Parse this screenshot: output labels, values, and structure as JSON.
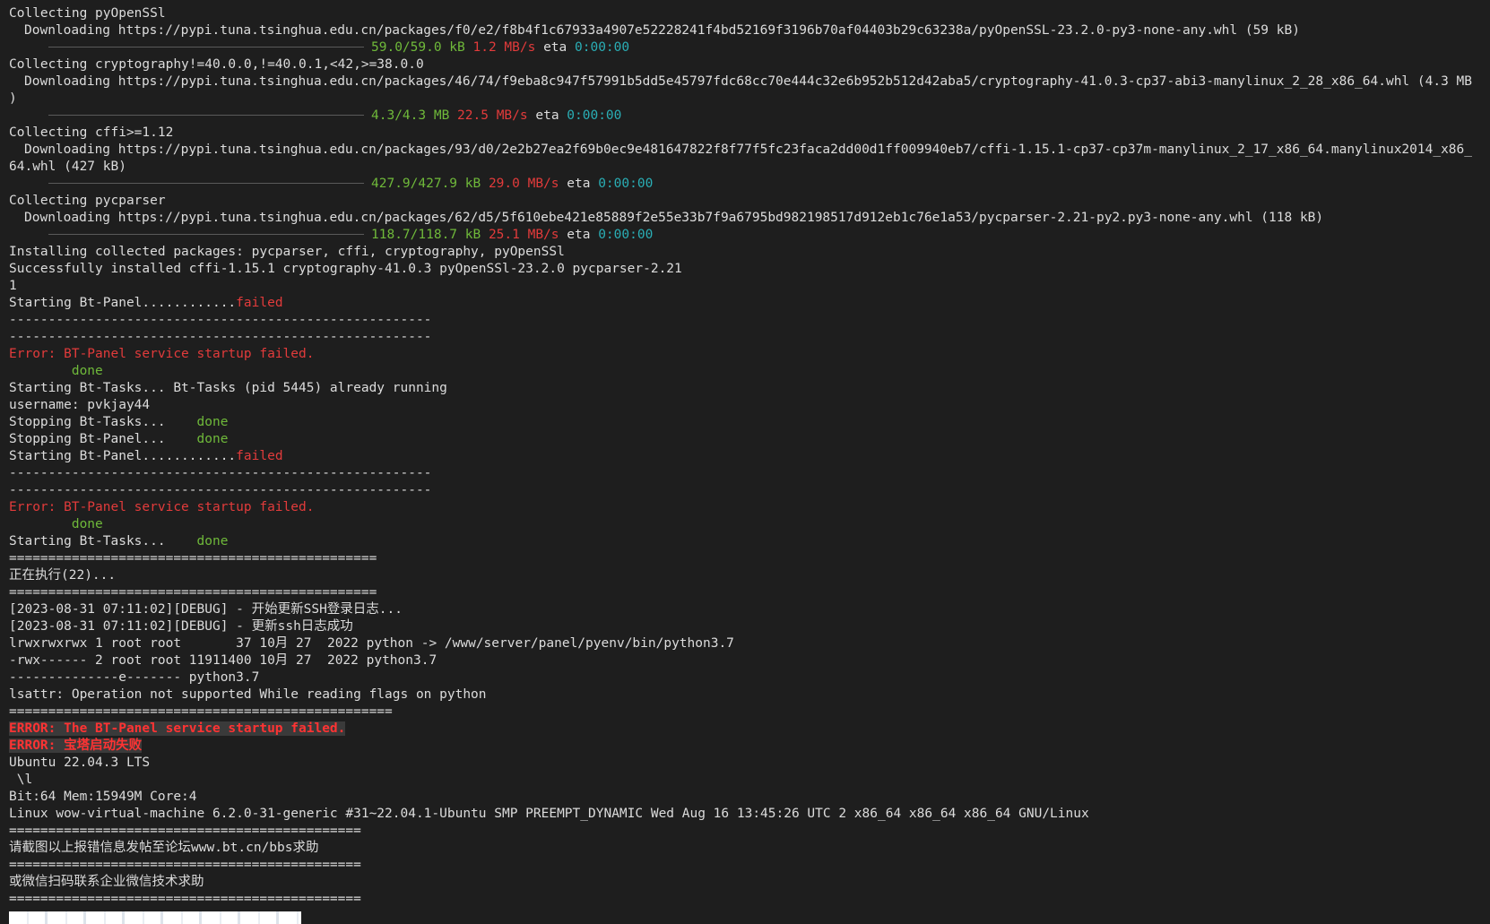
{
  "terminal": {
    "lines": [
      {
        "segments": [
          {
            "text": "Collecting pyOpenSSl",
            "color": "white"
          }
        ]
      },
      {
        "indent": true,
        "segments": [
          {
            "text": "Downloading https://pypi.tuna.tsinghua.edu.cn/packages/f0/e2/f8b4f1c67933a4907e52228241f4bd52169f3196b70af04403b29c63238a/pyOpenSSL-23.2.0-py3-none-any.whl (59 kB)",
            "color": "white"
          }
        ]
      },
      {
        "bar": true,
        "segments": [
          {
            "text": "59.0/59.0 kB",
            "color": "green"
          },
          {
            "text": " ",
            "color": "white"
          },
          {
            "text": "1.2 MB/s",
            "color": "red"
          },
          {
            "text": " eta ",
            "color": "white"
          },
          {
            "text": "0:00:00",
            "color": "cyan"
          }
        ]
      },
      {
        "segments": [
          {
            "text": "Collecting cryptography!=40.0.0,!=40.0.1,<42,>=38.0.0",
            "color": "white"
          }
        ]
      },
      {
        "indent": true,
        "segments": [
          {
            "text": "Downloading https://pypi.tuna.tsinghua.edu.cn/packages/46/74/f9eba8c947f57991b5dd5e45797fdc68cc70e444c32e6b952b512d42aba5/cryptography-41.0.3-cp37-abi3-manylinux_2_28_x86_64.whl (4.3 MB",
            "color": "white"
          }
        ]
      },
      {
        "segments": [
          {
            "text": ")",
            "color": "white"
          }
        ]
      },
      {
        "bar": true,
        "segments": [
          {
            "text": "4.3/4.3 MB",
            "color": "green"
          },
          {
            "text": " ",
            "color": "white"
          },
          {
            "text": "22.5 MB/s",
            "color": "red"
          },
          {
            "text": " eta ",
            "color": "white"
          },
          {
            "text": "0:00:00",
            "color": "cyan"
          }
        ]
      },
      {
        "segments": [
          {
            "text": "Collecting cffi>=1.12",
            "color": "white"
          }
        ]
      },
      {
        "indent": true,
        "segments": [
          {
            "text": "Downloading https://pypi.tuna.tsinghua.edu.cn/packages/93/d0/2e2b27ea2f69b0ec9e481647822f8f77f5fc23faca2dd00d1ff009940eb7/cffi-1.15.1-cp37-cp37m-manylinux_2_17_x86_64.manylinux2014_x86_",
            "color": "white"
          }
        ]
      },
      {
        "segments": [
          {
            "text": "64.whl (427 kB)",
            "color": "white"
          }
        ]
      },
      {
        "bar": true,
        "segments": [
          {
            "text": "427.9/427.9 kB",
            "color": "green"
          },
          {
            "text": " ",
            "color": "white"
          },
          {
            "text": "29.0 MB/s",
            "color": "red"
          },
          {
            "text": " eta ",
            "color": "white"
          },
          {
            "text": "0:00:00",
            "color": "cyan"
          }
        ]
      },
      {
        "segments": [
          {
            "text": "Collecting pycparser",
            "color": "white"
          }
        ]
      },
      {
        "indent": true,
        "segments": [
          {
            "text": "Downloading https://pypi.tuna.tsinghua.edu.cn/packages/62/d5/5f610ebe421e85889f2e55e33b7f9a6795bd982198517d912eb1c76e1a53/pycparser-2.21-py2.py3-none-any.whl (118 kB)",
            "color": "white"
          }
        ]
      },
      {
        "bar": true,
        "segments": [
          {
            "text": "118.7/118.7 kB",
            "color": "green"
          },
          {
            "text": " ",
            "color": "white"
          },
          {
            "text": "25.1 MB/s",
            "color": "red"
          },
          {
            "text": " eta ",
            "color": "white"
          },
          {
            "text": "0:00:00",
            "color": "cyan"
          }
        ]
      },
      {
        "segments": [
          {
            "text": "Installing collected packages: pycparser, cffi, cryptography, pyOpenSSl",
            "color": "white"
          }
        ]
      },
      {
        "segments": [
          {
            "text": "Successfully installed cffi-1.15.1 cryptography-41.0.3 pyOpenSSl-23.2.0 pycparser-2.21",
            "color": "white"
          }
        ]
      },
      {
        "segments": [
          {
            "text": "1",
            "color": "white"
          }
        ]
      },
      {
        "segments": [
          {
            "text": "Starting Bt-Panel............",
            "color": "white"
          },
          {
            "text": "failed",
            "color": "red"
          }
        ]
      },
      {
        "segments": [
          {
            "text": "------------------------------------------------------",
            "color": "white"
          }
        ]
      },
      {
        "segments": [
          {
            "text": "------------------------------------------------------",
            "color": "white"
          }
        ]
      },
      {
        "segments": [
          {
            "text": "Error: BT-Panel service startup failed.",
            "color": "err"
          }
        ]
      },
      {
        "segments": [
          {
            "text": "        done",
            "color": "green"
          }
        ]
      },
      {
        "segments": [
          {
            "text": "Starting Bt-Tasks... Bt-Tasks (pid 5445) already running",
            "color": "white"
          }
        ]
      },
      {
        "segments": [
          {
            "text": "username: pvkjay44",
            "color": "white"
          }
        ]
      },
      {
        "segments": [
          {
            "text": "Stopping Bt-Tasks...    ",
            "color": "white"
          },
          {
            "text": "done",
            "color": "green"
          }
        ]
      },
      {
        "segments": [
          {
            "text": "Stopping Bt-Panel...    ",
            "color": "white"
          },
          {
            "text": "done",
            "color": "green"
          }
        ]
      },
      {
        "segments": [
          {
            "text": "Starting Bt-Panel............",
            "color": "white"
          },
          {
            "text": "failed",
            "color": "red"
          }
        ]
      },
      {
        "segments": [
          {
            "text": "------------------------------------------------------",
            "color": "white"
          }
        ]
      },
      {
        "segments": [
          {
            "text": "------------------------------------------------------",
            "color": "white"
          }
        ]
      },
      {
        "segments": [
          {
            "text": "Error: BT-Panel service startup failed.",
            "color": "err"
          }
        ]
      },
      {
        "segments": [
          {
            "text": "        done",
            "color": "green"
          }
        ]
      },
      {
        "segments": [
          {
            "text": "Starting Bt-Tasks...    ",
            "color": "white"
          },
          {
            "text": "done",
            "color": "green"
          }
        ]
      },
      {
        "segments": [
          {
            "text": "===============================================",
            "color": "white"
          }
        ]
      },
      {
        "segments": [
          {
            "text": "正在执行(22)...",
            "color": "white"
          }
        ]
      },
      {
        "segments": [
          {
            "text": "===============================================",
            "color": "white"
          }
        ]
      },
      {
        "segments": [
          {
            "text": "[2023-08-31 07:11:02][DEBUG] - 开始更新SSH登录日志...",
            "color": "white"
          }
        ]
      },
      {
        "segments": [
          {
            "text": "[2023-08-31 07:11:02][DEBUG] - 更新ssh日志成功",
            "color": "white"
          }
        ]
      },
      {
        "segments": [
          {
            "text": "lrwxrwxrwx 1 root root       37 10月 27  2022 python -> /www/server/panel/pyenv/bin/python3.7",
            "color": "white"
          }
        ]
      },
      {
        "segments": [
          {
            "text": "-rwx------ 2 root root 11911400 10月 27  2022 python3.7",
            "color": "white"
          }
        ]
      },
      {
        "segments": [
          {
            "text": "--------------e------- python3.7",
            "color": "white"
          }
        ]
      },
      {
        "segments": [
          {
            "text": "lsattr: Operation not supported While reading flags on python",
            "color": "white"
          }
        ]
      },
      {
        "segments": [
          {
            "text": "=================================================",
            "color": "white"
          }
        ]
      },
      {
        "segments": [
          {
            "text": "ERROR: The BT-Panel service startup failed.",
            "color": "hl"
          }
        ]
      },
      {
        "segments": [
          {
            "text": "ERROR: 宝塔启动失败",
            "color": "hl"
          }
        ]
      },
      {
        "segments": [
          {
            "text": "Ubuntu 22.04.3 LTS",
            "color": "white"
          }
        ]
      },
      {
        "segments": [
          {
            "text": " \\l",
            "color": "white"
          }
        ]
      },
      {
        "segments": [
          {
            "text": "Bit:64 Mem:15949M Core:4",
            "color": "white"
          }
        ]
      },
      {
        "segments": [
          {
            "text": "Linux wow-virtual-machine 6.2.0-31-generic #31~22.04.1-Ubuntu SMP PREEMPT_DYNAMIC Wed Aug 16 13:45:26 UTC 2 x86_64 x86_64 x86_64 GNU/Linux",
            "color": "white"
          }
        ]
      },
      {
        "segments": [
          {
            "text": "=============================================",
            "color": "white"
          }
        ]
      },
      {
        "segments": [
          {
            "text": "请截图以上报错信息发帖至论坛www.bt.cn/bbs求助",
            "color": "white"
          }
        ]
      },
      {
        "segments": [
          {
            "text": "=============================================",
            "color": "white"
          }
        ]
      },
      {
        "segments": [
          {
            "text": "或微信扫码联系企业微信技术求助",
            "color": "white"
          }
        ]
      },
      {
        "segments": [
          {
            "text": "=============================================",
            "color": "white"
          }
        ]
      }
    ]
  }
}
